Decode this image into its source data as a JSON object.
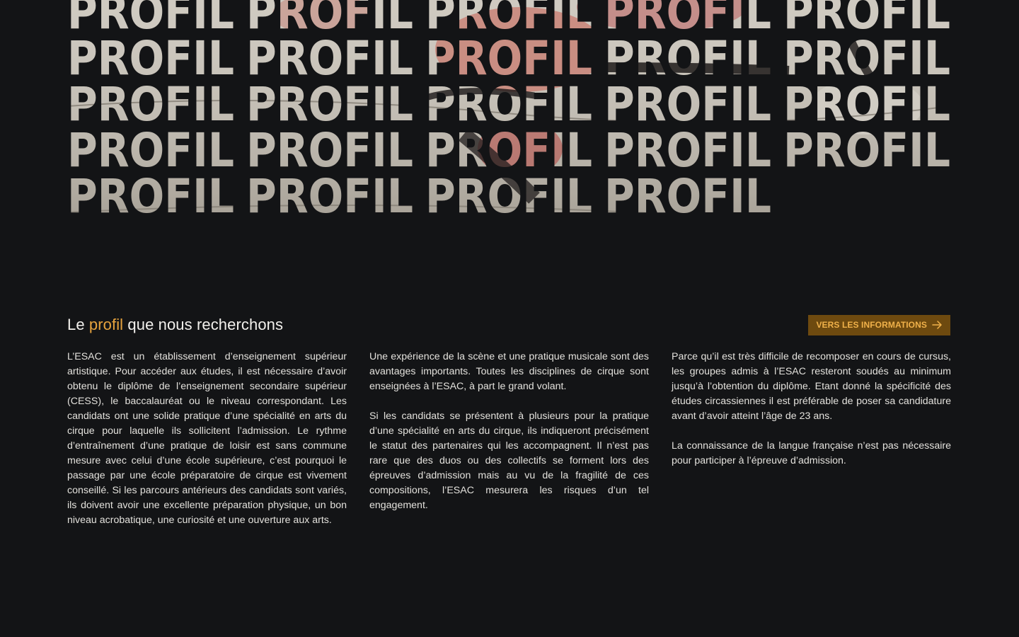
{
  "hero": {
    "word": "PROFIL",
    "colors": {
      "light": "#cdc8be",
      "mid": "#a39c90",
      "pink": "#c98b80",
      "dark": "#2a2624"
    }
  },
  "section": {
    "title_prefix": "Le",
    "title_accent": "profil",
    "title_suffix": "que nous recherchons",
    "cta_label": "VERS LES INFORMATIONS",
    "cta_icon": "arrow-right-icon",
    "accent_color": "#e6a33e"
  },
  "columns": [
    {
      "paragraphs": [
        "L’ESAC est un établissement d’enseignement supérieur artistique. Pour accéder aux études, il est nécessaire d’avoir obtenu le diplôme de l’enseignement secondaire supérieur (CESS), le baccalauréat ou le niveau correspondant. Les candidats ont une solide pratique d’une spécialité en arts du cirque pour laquelle ils sollicitent l’admission. Le rythme d’entraînement d’une pratique de loisir est sans commune mesure avec celui d’une école supérieure, c’est pourquoi le passage par une école préparatoire de cirque est vivement conseillé. Si les parcours antérieurs des candidats sont variés, ils doivent avoir une excellente préparation physique,  un bon niveau acrobatique, une curiosité et une ouverture aux arts."
      ]
    },
    {
      "paragraphs": [
        "Une expérience de la scène et une pratique musicale sont des avantages importants. Toutes les disciplines de cirque sont enseignées à l’ESAC, à part le grand volant.",
        "Si les candidats se présentent à plusieurs pour la pratique d’une spécialité en arts du cirque, ils indiqueront précisément le statut des partenaires qui les accompagnent. Il n’est pas rare que des duos ou des collectifs se forment lors des épreuves d’admission mais au vu de la fragilité de ces compositions, l’ESAC mesurera les risques d’un tel engagement."
      ]
    },
    {
      "paragraphs": [
        "Parce qu’il est très difficile de recomposer en cours de cursus, les groupes admis à l’ESAC resteront soudés au minimum jusqu’à l’obtention du diplôme. Etant donné la spécificité des études circassiennes il est préférable de poser sa candidature avant d’avoir atteint l’âge de 23 ans.",
        "La connaissance de la langue française n’est pas nécessaire pour participer à l’épreuve d’admission."
      ]
    }
  ]
}
